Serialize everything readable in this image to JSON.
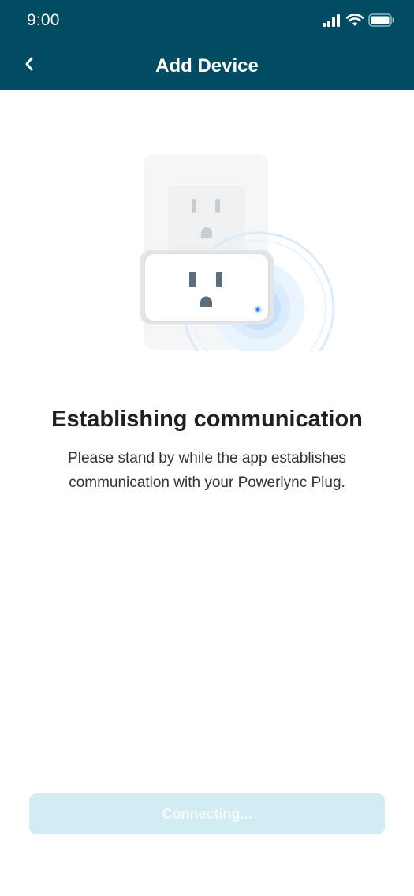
{
  "status_bar": {
    "time": "9:00",
    "icons": [
      "signal-icon",
      "wifi-icon",
      "battery-icon"
    ]
  },
  "header": {
    "title": "Add Device",
    "back_icon": "chevron-left-icon",
    "background_color": "#014b63"
  },
  "illustration": {
    "subject": "smart-plug-in-wall-outlet",
    "indicator_color": "#2f80ed"
  },
  "content": {
    "heading": "Establishing communication",
    "description": "Please stand by while the app establishes communication with your Powerlync Plug."
  },
  "button": {
    "label": "Connecting...",
    "state": "disabled",
    "background_color": "#d2ecf3"
  }
}
